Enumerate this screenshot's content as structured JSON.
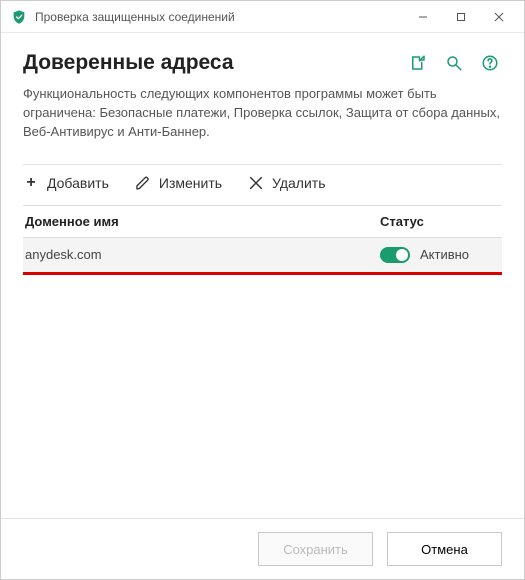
{
  "window": {
    "title": "Проверка защищенных соединений"
  },
  "header": {
    "title": "Доверенные адреса"
  },
  "description": "Функциональность следующих компонентов программы может быть ограничена: Безопасные платежи, Проверка ссылок, Защита от сбора данных, Веб-Антивирус и Анти-Баннер.",
  "toolbar": {
    "add": "Добавить",
    "edit": "Изменить",
    "delete": "Удалить"
  },
  "table": {
    "col_domain": "Доменное имя",
    "col_status": "Статус",
    "rows": [
      {
        "domain": "anydesk.com",
        "status": "Активно",
        "active": true
      }
    ]
  },
  "footer": {
    "save": "Сохранить",
    "cancel": "Отмена"
  }
}
